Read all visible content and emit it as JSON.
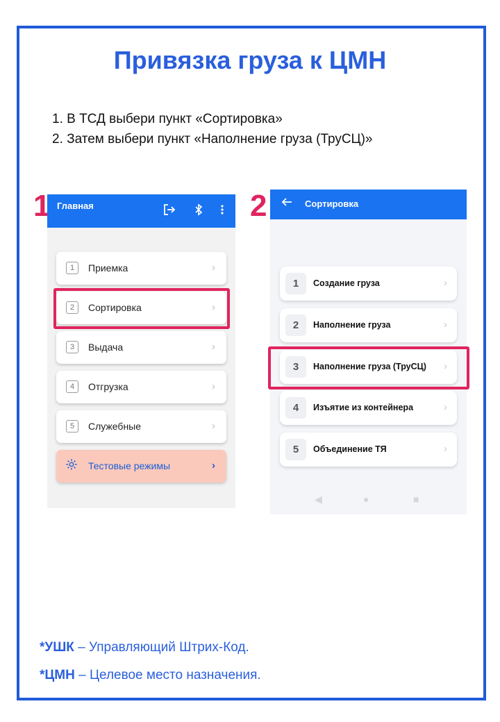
{
  "title": "Привязка груза к ЦМН",
  "steps": [
    "1. В ТСД выбери пункт «Сортировка»",
    "2. Затем выбери пункт «Наполнение груза (ТруСЦ)»"
  ],
  "screen1": {
    "number": "1",
    "header_title": "Главная",
    "icons": [
      "logout-icon",
      "bluetooth-icon",
      "more-vert-icon"
    ],
    "items": [
      {
        "num": "1",
        "label": "Приемка"
      },
      {
        "num": "2",
        "label": "Сортировка"
      },
      {
        "num": "3",
        "label": "Выдача"
      },
      {
        "num": "4",
        "label": "Отгрузка"
      },
      {
        "num": "5",
        "label": "Служебные"
      }
    ],
    "test_item": {
      "label": "Тестовые режимы",
      "icon": "gear-icon"
    }
  },
  "screen2": {
    "number": "2",
    "header_title": "Сортировка",
    "items": [
      {
        "num": "1",
        "label": "Создание груза"
      },
      {
        "num": "2",
        "label": "Наполнение груза"
      },
      {
        "num": "3",
        "label": "Наполнение груза (ТруСЦ)"
      },
      {
        "num": "4",
        "label": "Изъятие из контейнера"
      },
      {
        "num": "5",
        "label": "Объединение ТЯ"
      }
    ]
  },
  "notes": [
    {
      "term": "*УШК",
      "definition": " – Управляющий Штрих-Код."
    },
    {
      "term": "*ЦМН",
      "definition": " – Целевое место назначения."
    }
  ],
  "colors": {
    "accent": "#2a5fdc",
    "highlight": "#e0245e",
    "header": "#1a73f0",
    "test_bg": "#fbc9bc"
  }
}
